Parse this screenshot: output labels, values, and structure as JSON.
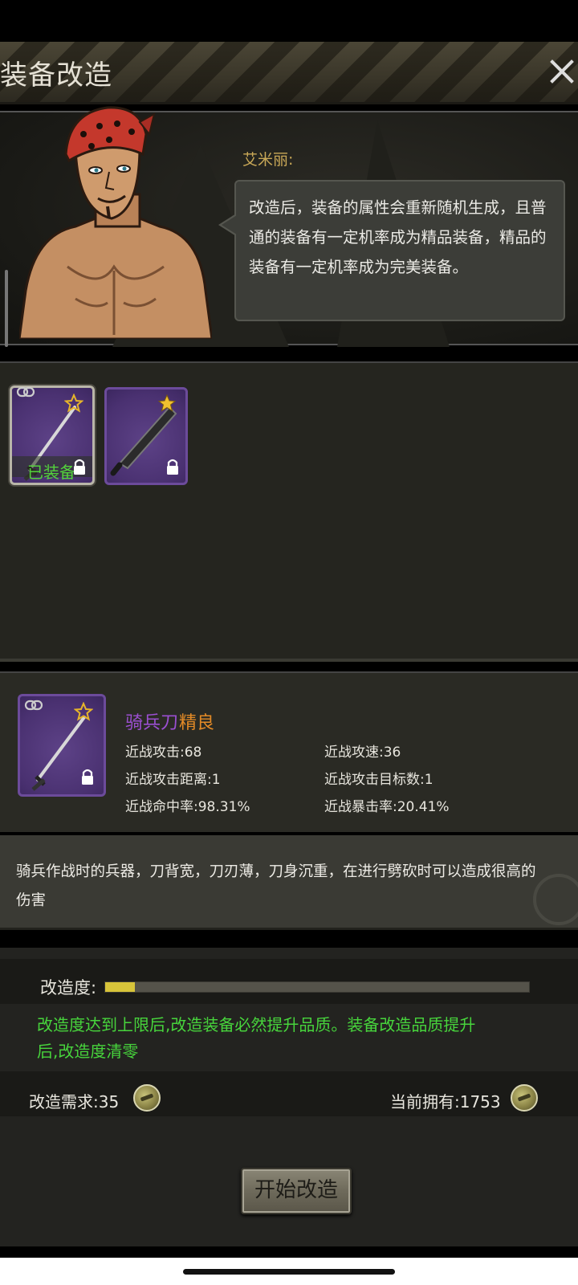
{
  "header": {
    "title": "装备改造",
    "close_icon": "close-icon"
  },
  "npc": {
    "name": "艾米丽:",
    "dialogue": "改造后，装备的属性会重新随机生成，且普通的装备有一定机率成为精品装备，精品的装备有一定机率成为完美装备。"
  },
  "inventory": {
    "slots": [
      {
        "item": "sabre",
        "status": "已装备",
        "selected": true,
        "icons": [
          "link-icon",
          "star-icon",
          "lock-icon"
        ]
      },
      {
        "item": "machete",
        "selected": false,
        "icons": [
          "star-icon",
          "lock-icon"
        ]
      }
    ]
  },
  "detail": {
    "name": "骑兵刀",
    "quality": "精良",
    "stats": {
      "melee_attack": "近战攻击:68",
      "melee_speed": "近战攻速:36",
      "melee_range": "近战攻击距离:1",
      "melee_targets": "近战攻击目标数:1",
      "melee_hit": "近战命中率:98.31%",
      "melee_crit": "近战暴击率:20.41%"
    },
    "description": "骑兵作战时的兵器，刀背宽，刀刃薄，刀身沉重，在进行劈砍时可以造成很高的伤害"
  },
  "progress": {
    "label": "改造度:",
    "value": 0.07,
    "rule": "改造度达到上限后,改造装备必然提升品质。装备改造品质提升后,改造度清零"
  },
  "cost": {
    "required_label": "改造需求:35",
    "owned_label": "当前拥有:1753",
    "currency_icon": "bottle-cap-coin-icon"
  },
  "actions": {
    "start_label": "开始改造"
  },
  "colors": {
    "rare_name": "#9b4fd1",
    "quality": "#e38a26",
    "rule_green": "#47d43c",
    "progress_fill": "#d7c43a",
    "npc_name": "#c9a857"
  }
}
